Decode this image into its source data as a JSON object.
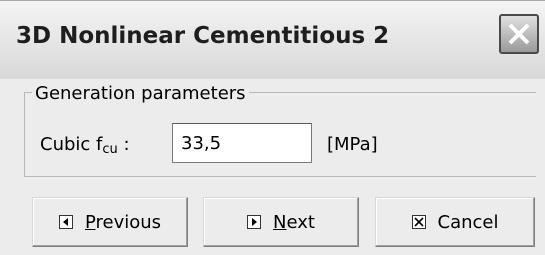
{
  "window": {
    "title": "3D Nonlinear Cementitious 2",
    "close_icon": "close-icon"
  },
  "group": {
    "legend": "Generation parameters"
  },
  "field": {
    "label_main": "Cubic f",
    "label_sub": "cu",
    "label_colon": " :",
    "value": "33,5",
    "unit": "[MPa]"
  },
  "buttons": {
    "previous": {
      "mnemonic": "P",
      "rest": "revious",
      "icon": "arrow-left-icon"
    },
    "next": {
      "mnemonic": "N",
      "rest": "ext",
      "icon": "arrow-right-icon"
    },
    "cancel": {
      "label": "Cancel",
      "icon": "close-box-icon"
    }
  },
  "colors": {
    "window_bg": "#ececec",
    "titlebar_top": "#f4f4f4",
    "titlebar_bottom": "#d8d8d8"
  }
}
